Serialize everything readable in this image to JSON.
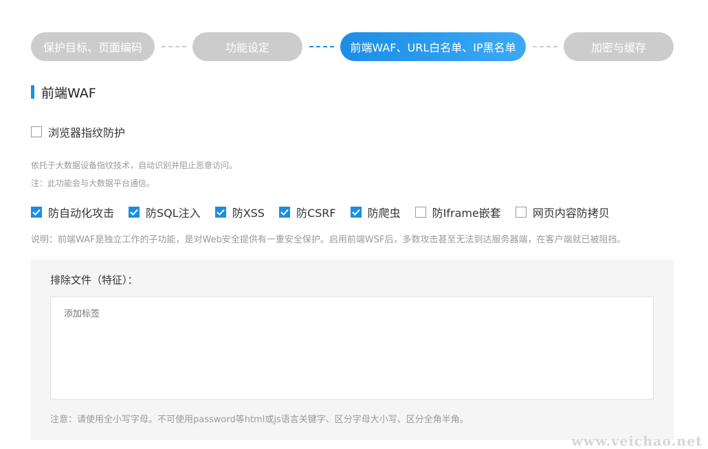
{
  "steps": [
    {
      "label": "保护目标、页面编码",
      "active": false
    },
    {
      "label": "功能设定",
      "active": false
    },
    {
      "label": "前端WAF、URL白名单、IP黑名单",
      "active": true
    },
    {
      "label": "加密与缓存",
      "active": false
    }
  ],
  "section": {
    "title": "前端WAF"
  },
  "fingerprint": {
    "label": "浏览器指纹防护",
    "checked": false
  },
  "fingerprint_desc": {
    "line1": "依托于大数据设备指纹技术，自动识别并阻止恶意访问。",
    "line2": "注：此功能会与大数据平台通信。"
  },
  "options": [
    {
      "label": "防自动化攻击",
      "checked": true
    },
    {
      "label": "防SQL注入",
      "checked": true
    },
    {
      "label": "防XSS",
      "checked": true
    },
    {
      "label": "防CSRF",
      "checked": true
    },
    {
      "label": "防爬虫",
      "checked": true
    },
    {
      "label": "防Iframe嵌套",
      "checked": false
    },
    {
      "label": "网页内容防拷贝",
      "checked": false
    }
  ],
  "note": "说明：前端WAF是独立工作的子功能，是对Web安全提供有一重安全保护。启用前端WSF后，多数攻击甚至无法到达服务器端，在客户端就已被阻挡。",
  "exclude": {
    "label": "排除文件（特征）：",
    "placeholder": "添加标签",
    "note": "注意：请使用全小写字母。不可使用password等html或js语言关键字、区分字母大小写、区分全角半角。"
  },
  "watermark": "www.veichao.net",
  "colors": {
    "accent": "#1a8ee6",
    "inactive_step": "#cccccc"
  }
}
